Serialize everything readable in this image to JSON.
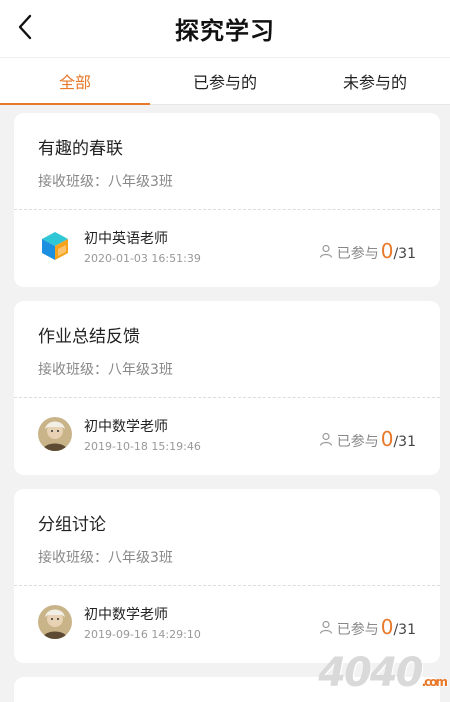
{
  "header": {
    "title": "探究学习"
  },
  "tabs": [
    {
      "label": "全部",
      "active": true
    },
    {
      "label": "已参与的",
      "active": false
    },
    {
      "label": "未参与的",
      "active": false
    }
  ],
  "cards": [
    {
      "title": "有趣的春联",
      "class_label": "接收班级：八年级3班",
      "teacher": "初中英语老师",
      "date": "2020-01-03 16:51:39",
      "participated_label": "已参与",
      "participated": "0",
      "total": "/31",
      "avatar": "cube-logo"
    },
    {
      "title": "作业总结反馈",
      "class_label": "接收班级：八年级3班",
      "teacher": "初中数学老师",
      "date": "2019-10-18 15:19:46",
      "participated_label": "已参与",
      "participated": "0",
      "total": "/31",
      "avatar": "person-photo"
    },
    {
      "title": "分组讨论",
      "class_label": "接收班级：八年级3班",
      "teacher": "初中数学老师",
      "date": "2019-09-16 14:29:10",
      "participated_label": "已参与",
      "participated": "0",
      "total": "/31",
      "avatar": "person-photo"
    }
  ],
  "watermark": {
    "text": "4040",
    "suffix": ".com"
  },
  "colors": {
    "accent": "#e8792b",
    "background": "#f2f2f2"
  }
}
